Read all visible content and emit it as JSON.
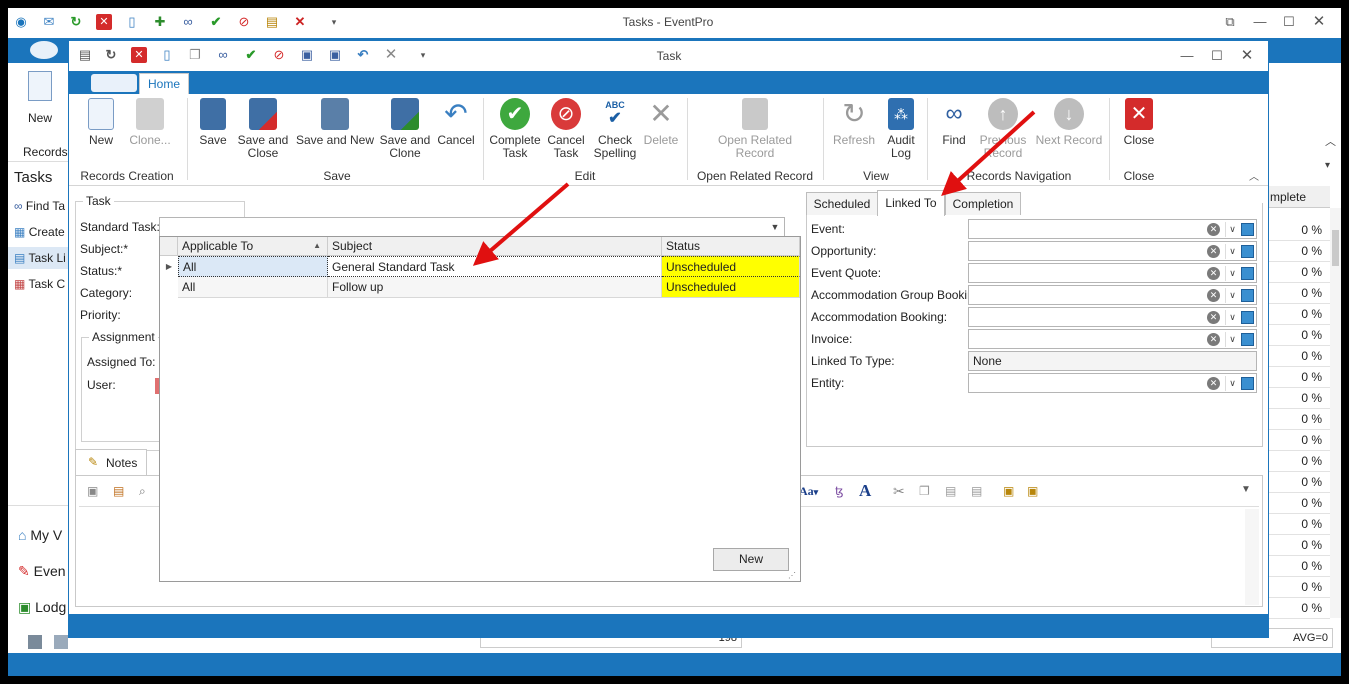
{
  "outer_window": {
    "title": "Tasks - EventPro",
    "ribbon_new_label": "New",
    "ribbon_group_label": "Records C",
    "panel_title": "Tasks",
    "nav": [
      {
        "label": "Find Ta"
      },
      {
        "label": "Create"
      },
      {
        "label": "Task Li"
      },
      {
        "label": "Task C"
      }
    ],
    "bottom_nav": [
      {
        "label": "My V"
      },
      {
        "label": "Even"
      },
      {
        "label": "Lodg"
      }
    ],
    "grid_header": "mplete",
    "percent_values": [
      "0 %",
      "0 %",
      "0 %",
      "0 %",
      "0 %",
      "0 %",
      "0 %",
      "0 %",
      "0 %",
      "0 %",
      "0 %",
      "0 %",
      "0 %",
      "0 %",
      "0 %",
      "0 %",
      "0 %",
      "0 %",
      "0 %"
    ],
    "footer_count": "198",
    "footer_avg": "AVG=0"
  },
  "task_window": {
    "title": "Task",
    "tab_home": "Home",
    "ribbon": {
      "new": "New",
      "clone": "Clone...",
      "records_creation": "Records Creation",
      "save": "Save",
      "save_close_1": "Save and",
      "save_close_2": "Close",
      "save_new": "Save and New",
      "save_clone_1": "Save and",
      "save_clone_2": "Clone",
      "cancel": "Cancel",
      "save_group": "Save",
      "complete_1": "Complete",
      "complete_2": "Task",
      "cancel_task_1": "Cancel",
      "cancel_task_2": "Task",
      "spell_1": "Check",
      "spell_2": "Spelling",
      "spell_badge": "ABC",
      "delete": "Delete",
      "edit_group": "Edit",
      "open_related_1": "Open Related",
      "open_related_2": "Record",
      "open_related_group": "Open Related Record",
      "refresh": "Refresh",
      "audit_1": "Audit",
      "audit_2": "Log",
      "view_group": "View",
      "find": "Find",
      "previous_1": "Previous",
      "previous_2": "Record",
      "next": "Next Record",
      "nav_group": "Records Navigation",
      "close": "Close",
      "close_group": "Close"
    },
    "task_group": "Task",
    "labels": {
      "standard_task": "Standard Task:",
      "subject": "Subject:*",
      "status": "Status:*",
      "category": "Category:",
      "priority": "Priority:",
      "assignment": "Assignment",
      "assigned_to": "Assigned To:",
      "user": "User:"
    },
    "notes_tab": "Notes",
    "dropdown": {
      "columns": [
        "Applicable To",
        "Subject",
        "Status"
      ],
      "rows": [
        {
          "applicable": "All",
          "subject": "General Standard Task",
          "status": "Unscheduled"
        },
        {
          "applicable": "All",
          "subject": "Follow up",
          "status": "Unscheduled"
        }
      ],
      "new_button": "New"
    },
    "right_tabs": [
      "Scheduled",
      "Linked To",
      "Completion"
    ],
    "linked_fields": [
      {
        "label": "Event:",
        "value": ""
      },
      {
        "label": "Opportunity:",
        "value": ""
      },
      {
        "label": "Event Quote:",
        "value": ""
      },
      {
        "label": "Accommodation Group Booking:",
        "value": ""
      },
      {
        "label": "Accommodation Booking:",
        "value": ""
      },
      {
        "label": "Invoice:",
        "value": ""
      },
      {
        "label": "Linked To Type:",
        "value": "None"
      },
      {
        "label": "Entity:",
        "value": ""
      }
    ],
    "font_button": "Aa",
    "font_dd": "▾"
  },
  "colors": {
    "accent_blue": "#1b75bc",
    "status_yellow": "#ffff00",
    "annotation_red": "#e01010"
  }
}
